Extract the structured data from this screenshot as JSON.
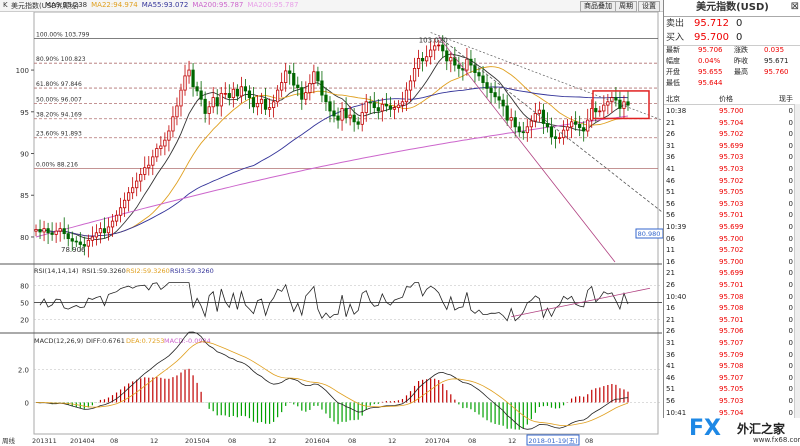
{
  "header": {
    "period_label": "K",
    "instrument": "美元指数(USD)(周线)",
    "ma_items": [
      {
        "label": "MA9:95.238",
        "color": "#333333"
      },
      {
        "label": "MA22:94.974",
        "color": "#e0a020"
      },
      {
        "label": "MA55:93.072",
        "color": "#333399"
      },
      {
        "label": "MA200:95.787",
        "color": "#cc66cc"
      },
      {
        "label": "MA200:95.787",
        "color": "#e8a0e8"
      }
    ],
    "buttons": [
      "商品叠加",
      "周期",
      "设置"
    ]
  },
  "fib_labels": [
    "100.00% 103.799",
    "80.90% 100.823",
    "61.80% 97.846",
    "50.00% 96.007",
    "38.20% 94.169",
    "23.60% 91.893",
    "0.00% 88.216"
  ],
  "peak_label": "103.020",
  "low_label": "78.906",
  "price_axis": [
    "100",
    "95",
    "90",
    "85",
    "80"
  ],
  "right_axis_label": "80.980",
  "rsi_header": {
    "name": "RSI(14,14,14)",
    "r1": "RSI1:59.3260",
    "r2": "RSI2:59.3260",
    "r3": "RSI3:59.3260"
  },
  "rsi_axis": [
    "80",
    "50",
    "20"
  ],
  "macd_header": {
    "name": "MACD(12,26,9)",
    "diff": "DIFF:0.6761",
    "dea": "DEA:0.7253",
    "macd": "MACD:-0.0984"
  },
  "macd_axis": [
    "2.0",
    "0"
  ],
  "x_axis": [
    "周线",
    "201311",
    "201404",
    "08",
    "12",
    "201504",
    "08",
    "12",
    "201604",
    "08",
    "12",
    "201704",
    "08",
    "12",
    "08"
  ],
  "cursor_date": "2018-01-19(五)",
  "chart_data": {
    "type": "candlestick",
    "title": "美元指数(USD)(周线)",
    "ylim": [
      77,
      106
    ],
    "x_range": [
      "201311",
      "201803"
    ],
    "weekly_close": [
      80.9,
      80.6,
      81.0,
      80.5,
      80.3,
      80.7,
      81.0,
      80.4,
      79.8,
      79.5,
      79.4,
      79.1,
      78.9,
      79.6,
      80.0,
      80.5,
      81.0,
      80.5,
      81.2,
      81.9,
      82.6,
      83.5,
      84.4,
      85.3,
      85.9,
      86.7,
      87.5,
      88.3,
      88.6,
      89.6,
      90.6,
      90.9,
      91.6,
      92.7,
      94.4,
      95.7,
      97.6,
      99.3,
      100.0,
      98.0,
      97.5,
      96.5,
      94.8,
      95.6,
      96.7,
      95.7,
      97.2,
      97.2,
      96.7,
      97.7,
      96.9,
      98.0,
      97.5,
      96.7,
      95.6,
      96.0,
      96.5,
      95.3,
      95.5,
      96.2,
      97.6,
      98.5,
      99.9,
      99.6,
      98.2,
      97.9,
      96.5,
      97.3,
      98.4,
      99.8,
      98.7,
      97.0,
      96.2,
      95.1,
      94.5,
      94.0,
      95.4,
      94.3,
      94.6,
      93.8,
      93.5,
      94.9,
      96.2,
      96.1,
      95.5,
      95.1,
      95.9,
      95.7,
      95.3,
      95.5,
      95.8,
      96.2,
      97.6,
      98.7,
      100.2,
      101.4,
      101.1,
      101.6,
      102.4,
      102.9,
      103.0,
      102.3,
      101.1,
      101.5,
      100.6,
      100.2,
      100.0,
      101.3,
      100.6,
      99.7,
      99.3,
      98.5,
      97.8,
      97.3,
      96.8,
      96.4,
      95.7,
      94.0,
      94.3,
      93.2,
      92.6,
      92.5,
      93.2,
      93.9,
      94.8,
      95.2,
      93.6,
      93.2,
      92.0,
      91.8,
      91.9,
      92.8,
      93.2,
      93.8,
      93.5,
      93.1,
      92.7,
      94.0,
      95.4,
      95.0,
      95.1,
      95.8,
      96.2,
      96.7,
      96.4,
      95.4,
      96.2,
      95.8
    ],
    "fib_levels": [
      {
        "ratio": "100.00%",
        "value": 103.799
      },
      {
        "ratio": "80.90%",
        "value": 100.823
      },
      {
        "ratio": "61.80%",
        "value": 97.846
      },
      {
        "ratio": "50.00%",
        "value": 96.007
      },
      {
        "ratio": "38.20%",
        "value": 94.169
      },
      {
        "ratio": "23.60%",
        "value": 91.893
      },
      {
        "ratio": "0.00%",
        "value": 88.216
      }
    ],
    "ma": {
      "MA9": 95.238,
      "MA22": 94.974,
      "MA55": 93.072,
      "MA200": 95.787
    },
    "rsi": {
      "ylim": [
        0,
        100
      ],
      "RSI1": 59.326,
      "RSI2": 59.326,
      "RSI3": 59.326
    },
    "macd": {
      "DIFF": 0.6761,
      "DEA": 0.7253,
      "MACD": -0.0984
    }
  },
  "quote": {
    "title": "美元指数(USD)",
    "sell": {
      "label": "卖出",
      "value": "95.712",
      "change": "0"
    },
    "buy": {
      "label": "买入",
      "value": "95.700",
      "change": "0"
    },
    "stats": [
      {
        "k": "最新",
        "v": "95.706",
        "k2": "涨跌",
        "v2": "0.035"
      },
      {
        "k": "幅度",
        "v": "0.04%",
        "k2": "昨收",
        "v2": "95.671"
      },
      {
        "k": "开盘",
        "v": "95.655",
        "k2": "最高",
        "v2": "95.760"
      },
      {
        "k": "最低",
        "v": "95.644",
        "k2": "",
        "v2": ""
      }
    ],
    "tick_head": {
      "time": "北京",
      "price": "价格",
      "vol": "现手"
    },
    "ticks": [
      {
        "t": "10:38",
        "p": "95.700",
        "v": "0"
      },
      {
        "t": "21",
        "p": "95.704",
        "v": "0"
      },
      {
        "t": "26",
        "p": "95.702",
        "v": "0"
      },
      {
        "t": "31",
        "p": "95.699",
        "v": "0"
      },
      {
        "t": "36",
        "p": "95.703",
        "v": "0"
      },
      {
        "t": "41",
        "p": "95.703",
        "v": "0"
      },
      {
        "t": "46",
        "p": "95.702",
        "v": "0"
      },
      {
        "t": "51",
        "p": "95.705",
        "v": "0"
      },
      {
        "t": "56",
        "p": "95.703",
        "v": "0"
      },
      {
        "t": "56",
        "p": "95.701",
        "v": "0"
      },
      {
        "t": "10:39",
        "p": "95.699",
        "v": "0"
      },
      {
        "t": "06",
        "p": "95.700",
        "v": "0"
      },
      {
        "t": "11",
        "p": "95.702",
        "v": "0"
      },
      {
        "t": "16",
        "p": "95.700",
        "v": "0"
      },
      {
        "t": "21",
        "p": "95.699",
        "v": "0"
      },
      {
        "t": "26",
        "p": "95.701",
        "v": "0"
      },
      {
        "t": "10:40",
        "p": "95.708",
        "v": "0"
      },
      {
        "t": "16",
        "p": "95.708",
        "v": "0"
      },
      {
        "t": "21",
        "p": "95.701",
        "v": "0"
      },
      {
        "t": "26",
        "p": "95.706",
        "v": "0"
      },
      {
        "t": "31",
        "p": "95.707",
        "v": "0"
      },
      {
        "t": "36",
        "p": "95.709",
        "v": "0"
      },
      {
        "t": "41",
        "p": "95.708",
        "v": "0"
      },
      {
        "t": "46",
        "p": "95.707",
        "v": "0"
      },
      {
        "t": "51",
        "p": "95.705",
        "v": "0"
      },
      {
        "t": "56",
        "p": "95.703",
        "v": "0"
      },
      {
        "t": "10:41",
        "p": "95.704",
        "v": "0"
      }
    ]
  },
  "logo": {
    "fx": "FX",
    "cn": "外汇之家",
    "url": "www.fx68.com"
  }
}
